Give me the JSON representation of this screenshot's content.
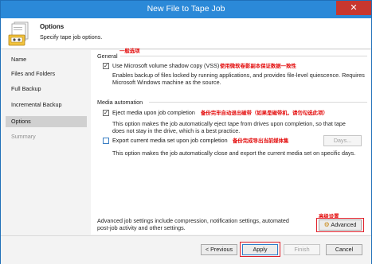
{
  "window": {
    "title": "New File to Tape Job",
    "close_glyph": "✕"
  },
  "header": {
    "title": "Options",
    "subtitle": "Specify tape job options.",
    "icon": "tape-job-icon"
  },
  "sidebar": {
    "items": [
      {
        "label": "Name"
      },
      {
        "label": "Files and Folders"
      },
      {
        "label": "Full Backup"
      },
      {
        "label": "Incremental Backup"
      },
      {
        "label": "Options"
      },
      {
        "label": "Summary"
      }
    ]
  },
  "general": {
    "section_label": "General",
    "annotation": "一般选项",
    "vss": {
      "checked": true,
      "label": "Use Microsoft volume shadow copy (VSS)",
      "annotation": "使用微软卷影副本保证数据一致性",
      "description": "Enables backup of files locked by running applications, and provides file-level quiescence. Requires Microsoft Windows machine as the source."
    }
  },
  "media": {
    "section_label": "Media automation",
    "eject": {
      "checked": true,
      "label": "Eject media upon job completion",
      "annotation": "备份完毕自动退出磁带（如果是磁带机，请勿勾选此项）",
      "description": "This option makes the job automatically eject tape from drives upon completion, so that tape does not stay in the drive, which is a best practice."
    },
    "export": {
      "checked": false,
      "label": "Export current media set upon job completion",
      "annotation": "备份完成导出当前媒体集",
      "description": "This option makes the job automatically close and export the current media set on specific days.",
      "days_button": "Days..."
    }
  },
  "advanced": {
    "text": "Advanced job settings include compression, notification settings, automated post-job activity and other settings.",
    "annotation": "高级设置",
    "button": "Advanced"
  },
  "footer": {
    "previous": "< Previous",
    "apply": "Apply",
    "finish": "Finish",
    "cancel": "Cancel"
  },
  "colors": {
    "titlebar": "#2b89d8",
    "close": "#c7372f",
    "annotation": "#e30b0b",
    "selected_nav": "#d0d0d0"
  }
}
